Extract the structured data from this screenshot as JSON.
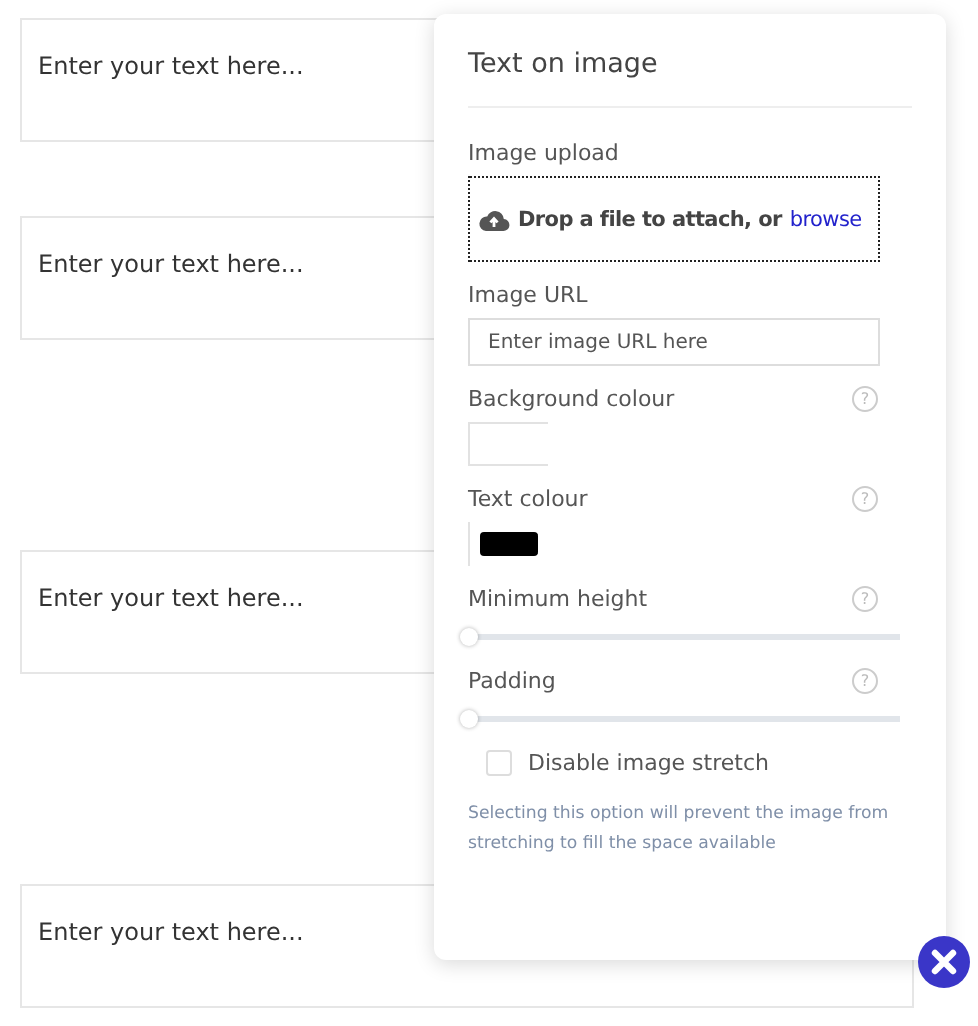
{
  "blocks": [
    {
      "placeholder": "Enter your text here..."
    },
    {
      "placeholder": "Enter your text here..."
    },
    {
      "placeholder": "Enter your text here..."
    },
    {
      "placeholder": "Enter your text here..."
    }
  ],
  "panel": {
    "title": "Text on image",
    "fields": [
      {
        "kind": "upload",
        "label": "Image upload",
        "prompt": "Drop a file to attach, or",
        "link": "browse"
      },
      {
        "kind": "text",
        "label": "Image URL",
        "placeholder": "Enter image URL here"
      },
      {
        "kind": "color",
        "label": "Background colour",
        "color": "#ffffff",
        "help": "?"
      },
      {
        "kind": "color",
        "label": "Text colour",
        "color": "#000000",
        "help": "?"
      },
      {
        "kind": "slider",
        "label": "Minimum height",
        "level": 0,
        "help": "?"
      },
      {
        "kind": "slider",
        "label": "Padding",
        "level": 0,
        "help": "?"
      },
      {
        "kind": "checkbox",
        "label": "Disable image stretch",
        "checked": false,
        "note": "Selecting this option will prevent the image from stretching to fill the space available"
      }
    ]
  }
}
